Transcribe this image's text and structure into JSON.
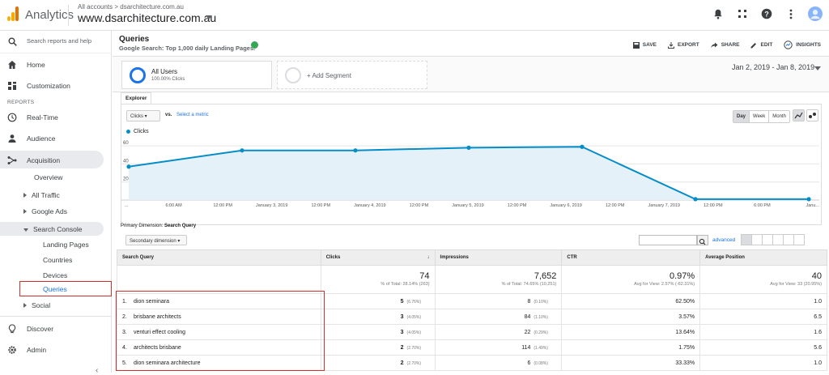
{
  "header": {
    "app_title": "Analytics",
    "breadcrumb": "All accounts > dsarchitecture.com.au",
    "property": "www.dsarchitecture.com.au"
  },
  "colors": {
    "accent": "#1a73e8",
    "highlight": "#d32f2f",
    "series": "#058dc7"
  },
  "sidebar": {
    "search_placeholder": "Search reports and help",
    "home": "Home",
    "customization": "Customization",
    "reports_label": "REPORTS",
    "realtime": "Real-Time",
    "audience": "Audience",
    "acquisition": "Acquisition",
    "overview": "Overview",
    "all_traffic": "All Traffic",
    "google_ads": "Google Ads",
    "search_console": "Search Console",
    "landing_pages": "Landing Pages",
    "countries": "Countries",
    "devices": "Devices",
    "queries": "Queries",
    "social": "Social",
    "discover": "Discover",
    "admin": "Admin"
  },
  "report": {
    "title": "Queries",
    "subtitle": "Google Search: Top 1,000 daily Landing Pages.",
    "actions": {
      "save": "SAVE",
      "export": "EXPORT",
      "share": "SHARE",
      "edit": "EDIT",
      "insights": "INSIGHTS"
    },
    "segment_name": "All Users",
    "segment_pct": "100.00% Clicks",
    "add_segment": "+ Add Segment",
    "date_range": "Jan 2, 2019 - Jan 8, 2019",
    "tab": "Explorer",
    "metric": "Clicks",
    "vs": "vs.",
    "select_metric": "Select a metric",
    "gran": {
      "day": "Day",
      "week": "Week",
      "month": "Month"
    },
    "primary_dimension_label": "Primary Dimension:",
    "primary_dimension": "Search Query",
    "secondary_dimension": "Secondary dimension",
    "advanced": "advanced"
  },
  "chart_data": {
    "type": "line",
    "series": [
      {
        "name": "Clicks",
        "values": [
          37,
          55,
          55,
          58,
          59,
          1,
          1
        ]
      }
    ],
    "x": [
      "January 2, 2019",
      "January 3, 2019",
      "January 4, 2019",
      "January 5, 2019",
      "January 6, 2019",
      "January 7, 2019",
      "January 8, 2019"
    ],
    "tick_labels": [
      "...",
      "6:00 AM",
      "12:00 PM",
      "January 3, 2019",
      "12:00 PM",
      "January 4, 2019",
      "12:00 PM",
      "January 5, 2019",
      "12:00 PM",
      "January 6, 2019",
      "12:00 PM",
      "January 7, 2019",
      "12:00 PM",
      "6:00 PM",
      "Janu..."
    ],
    "y_ticks": [
      "20",
      "40",
      "60"
    ],
    "ylim": [
      0,
      70
    ],
    "grid": true
  },
  "table": {
    "headers": {
      "query": "Search Query",
      "clicks": "Clicks",
      "impressions": "Impressions",
      "ctr": "CTR",
      "position": "Average Position"
    },
    "totals": {
      "clicks": "74",
      "clicks_sub": "% of Total: 28.14% (263)",
      "impressions": "7,652",
      "impressions_sub": "% of Total: 74.65% (10,251)",
      "ctr": "0.97%",
      "ctr_sub": "Avg for View: 2.57% (-62.31%)",
      "position": "40",
      "position_sub": "Avg for View: 33 (20.95%)"
    },
    "rows": [
      {
        "idx": "1.",
        "query": "dion seminara",
        "clicks": "5",
        "clicks_pct": "(6.76%)",
        "impr": "8",
        "impr_pct": "(0.10%)",
        "ctr": "62.50%",
        "pos": "1.0"
      },
      {
        "idx": "2.",
        "query": "brisbane architects",
        "clicks": "3",
        "clicks_pct": "(4.05%)",
        "impr": "84",
        "impr_pct": "(1.10%)",
        "ctr": "3.57%",
        "pos": "6.5"
      },
      {
        "idx": "3.",
        "query": "venturi effect cooling",
        "clicks": "3",
        "clicks_pct": "(4.05%)",
        "impr": "22",
        "impr_pct": "(0.29%)",
        "ctr": "13.64%",
        "pos": "1.6"
      },
      {
        "idx": "4.",
        "query": "architects brisbane",
        "clicks": "2",
        "clicks_pct": "(2.70%)",
        "impr": "114",
        "impr_pct": "(1.49%)",
        "ctr": "1.75%",
        "pos": "5.6"
      },
      {
        "idx": "5.",
        "query": "dion seminara architecture",
        "clicks": "2",
        "clicks_pct": "(2.70%)",
        "impr": "6",
        "impr_pct": "(0.08%)",
        "ctr": "33.33%",
        "pos": "1.0"
      }
    ]
  }
}
